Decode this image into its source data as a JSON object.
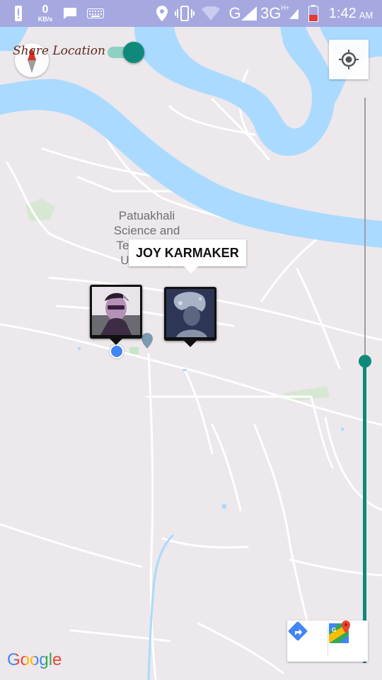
{
  "status_bar": {
    "net_speed_value": "0",
    "net_speed_unit": "KB/s",
    "network_g": "G",
    "network_3g": "3G",
    "network_3g_sup": "H+",
    "time": "1:42",
    "ampm": "AM"
  },
  "header": {
    "share_location_label": "Share Location",
    "toggle_on": true
  },
  "map": {
    "place_label_lines": [
      "Patuakhali",
      "Science and",
      "Technology",
      "University"
    ],
    "info_window_title": "JOY KARMAKER",
    "attribution": "Google"
  },
  "colors": {
    "accent": "#0f8a7a",
    "water": "#aadaff",
    "status_bar": "#a6a9e0",
    "map_bg": "#ece8ec",
    "my_location": "#4285f4"
  },
  "icons": {
    "compass": "compass-icon",
    "locate": "my-location-icon",
    "directions": "directions-icon",
    "google_maps": "google-maps-icon"
  }
}
